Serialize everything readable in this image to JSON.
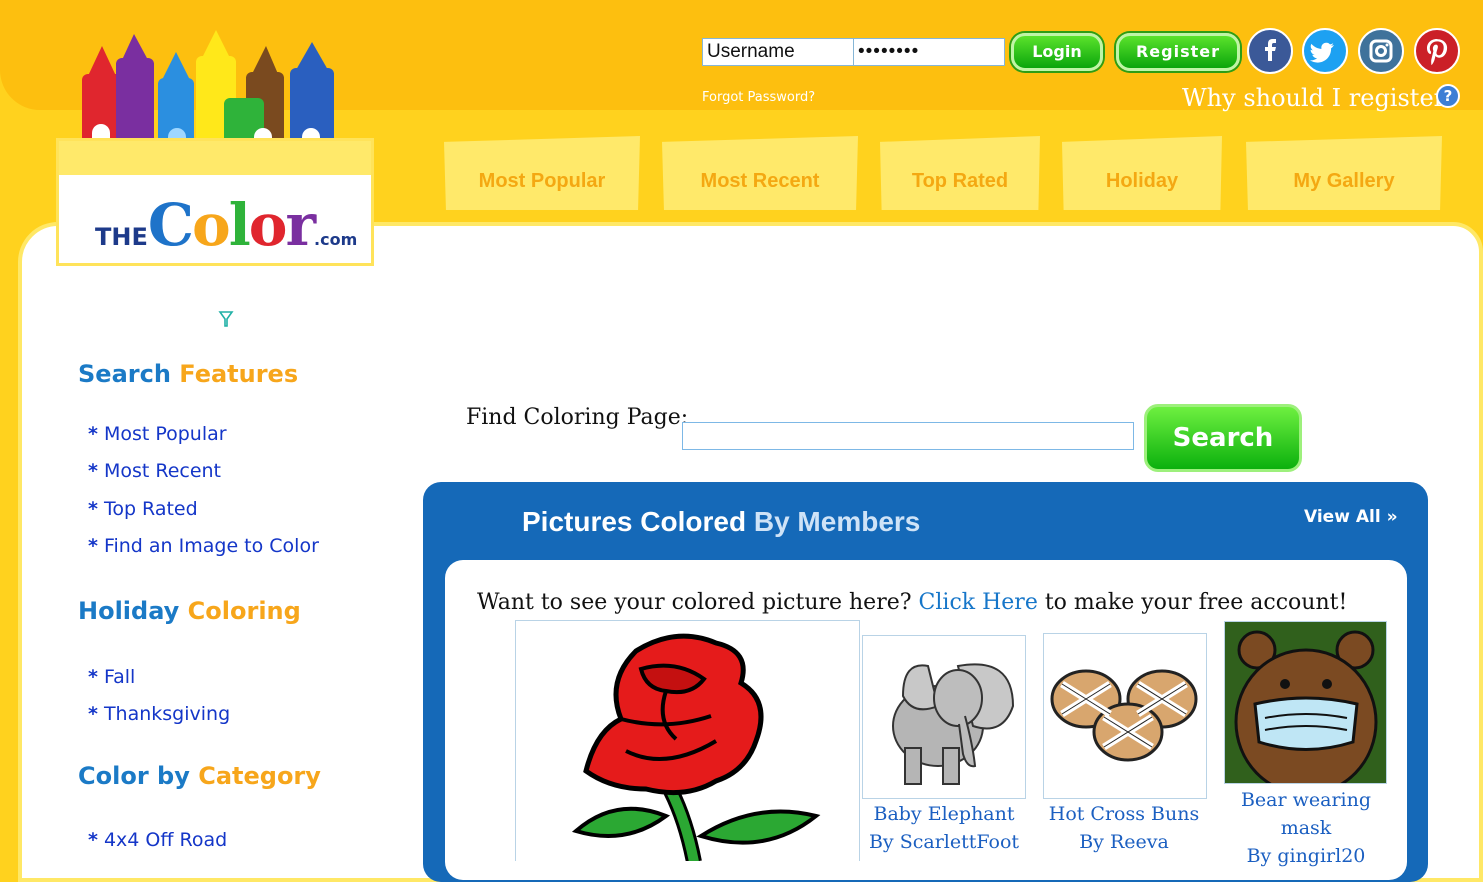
{
  "site": {
    "logo_prefix": "THE",
    "logo_name": "Color",
    "logo_suffix": ".com"
  },
  "login": {
    "username_value": "Username",
    "password_value": "••••••••",
    "login_label": "Login",
    "register_label": "Register",
    "forgot_label": "Forgot Password?",
    "why_label": "Why should I register",
    "help_glyph": "?"
  },
  "social": [
    {
      "name": "facebook",
      "glyph": "f",
      "color": "#3b5998"
    },
    {
      "name": "twitter",
      "glyph": "t",
      "color": "#1da1f2"
    },
    {
      "name": "instagram",
      "glyph": "ig",
      "color": "#3f729b"
    },
    {
      "name": "pinterest",
      "glyph": "p",
      "color": "#cb2027"
    }
  ],
  "tabs": [
    "Most Popular",
    "Most Recent",
    "Top Rated",
    "Holiday",
    "My Gallery"
  ],
  "sidebar": {
    "search_features": {
      "title_a": "Search",
      "title_b": "Features",
      "items": [
        "Most Popular",
        "Most Recent",
        "Top Rated",
        "Find an Image to Color"
      ]
    },
    "holiday": {
      "title_a": "Holiday",
      "title_b": "Coloring",
      "items": [
        "Fall",
        "Thanksgiving"
      ]
    },
    "category": {
      "title_a": "Color by",
      "title_b": "Category",
      "items": [
        "4x4 Off Road"
      ]
    }
  },
  "search": {
    "label": "Find Coloring Page:",
    "value": "",
    "button": "Search"
  },
  "members": {
    "title_a": "Pictures Colored",
    "title_b": "By",
    "title_c": "Members",
    "view_all": "View All »",
    "want_text": "Want to see your colored picture here?",
    "click_here": "Click Here",
    "want_tail": "to make your free account!",
    "pictures": [
      {
        "title": "Baby Elephant",
        "author": "By ScarlettFoot"
      },
      {
        "title": "Hot Cross Buns",
        "author": "By Reeva"
      },
      {
        "title": "Bear wearing mask",
        "title_line1": "Bear wearing",
        "title_line2": "mask",
        "author": "By gingirl20"
      }
    ]
  },
  "colors": {
    "accent_yellow": "#fdbf0f",
    "panel_blue": "#1569b8",
    "link_blue": "#1436c8",
    "green_button": "#0aa50c"
  }
}
